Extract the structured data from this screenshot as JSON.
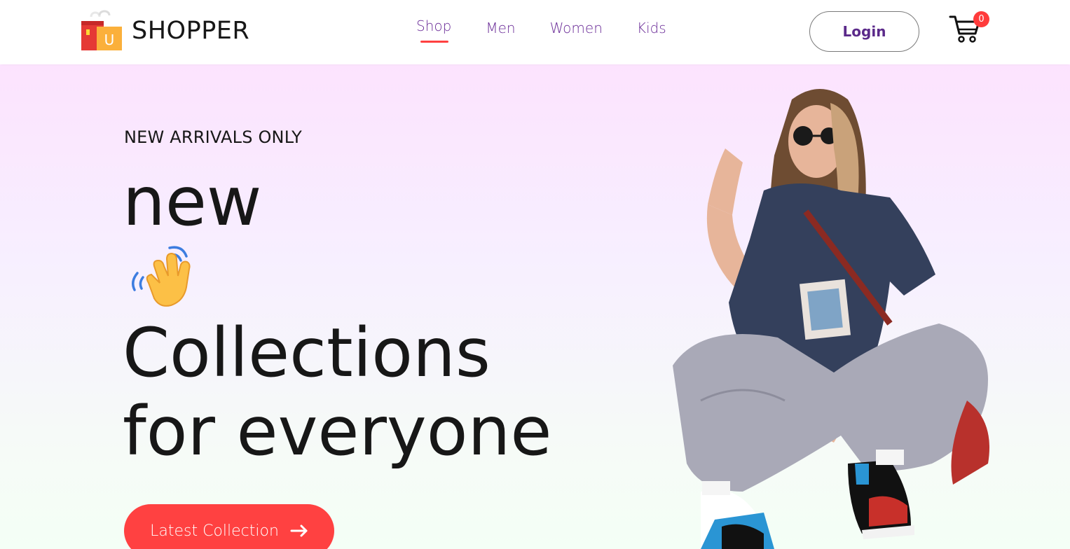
{
  "navbar": {
    "logo_text": "SHOPPER",
    "logo_badge": "U",
    "menu": [
      {
        "label": "Shop",
        "active": true
      },
      {
        "label": "Men",
        "active": false
      },
      {
        "label": "Women",
        "active": false
      },
      {
        "label": "Kids",
        "active": false
      }
    ],
    "login_label": "Login",
    "cart_count": "0"
  },
  "hero": {
    "tag": "NEW ARRIVALS ONLY",
    "line1": "new",
    "line2": "Collections",
    "line3": "for everyone",
    "cta_label": "Latest Collection"
  },
  "icons": {
    "logo": "shopping-bag-icon",
    "hand": "waving-hand-icon",
    "cart": "cart-icon",
    "arrow": "arrow-right-icon"
  },
  "colors": {
    "accent": "#ff4141",
    "nav_text": "#6b2d98",
    "hero_gradient_top": "#fce3fe",
    "hero_gradient_bottom": "#f4fff6"
  }
}
